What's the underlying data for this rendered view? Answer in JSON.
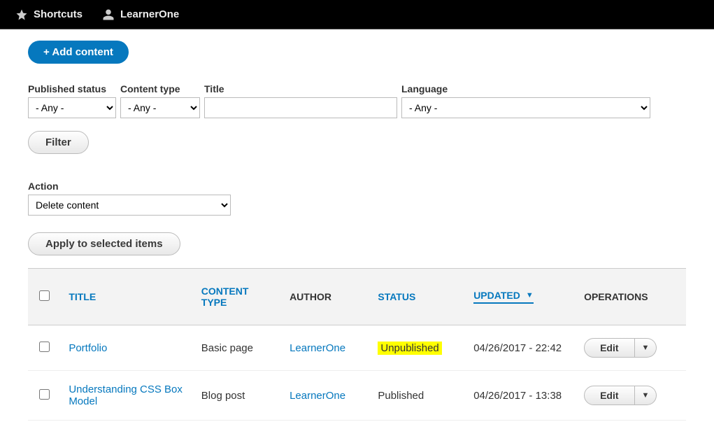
{
  "toolbar": {
    "shortcuts": "Shortcuts",
    "username": "LearnerOne"
  },
  "add_content_label": "+ Add content",
  "filters": {
    "published_label": "Published status",
    "content_type_label": "Content type",
    "title_label": "Title",
    "language_label": "Language",
    "any_option": "- Any -",
    "title_value": "",
    "filter_button": "Filter"
  },
  "action": {
    "label": "Action",
    "selected": "Delete content",
    "apply_button": "Apply to selected items"
  },
  "table": {
    "headers": {
      "title": "TITLE",
      "content_type": "CONTENT TYPE",
      "author": "AUTHOR",
      "status": "STATUS",
      "updated": "UPDATED",
      "operations": "OPERATIONS"
    },
    "rows": [
      {
        "title": "Portfolio",
        "content_type": "Basic page",
        "author": "LearnerOne",
        "status": "Unpublished",
        "status_highlight": true,
        "updated": "04/26/2017 - 22:42",
        "edit": "Edit"
      },
      {
        "title": "Understanding CSS Box Model",
        "content_type": "Blog post",
        "author": "LearnerOne",
        "status": "Published",
        "status_highlight": false,
        "updated": "04/26/2017 - 13:38",
        "edit": "Edit"
      }
    ]
  }
}
